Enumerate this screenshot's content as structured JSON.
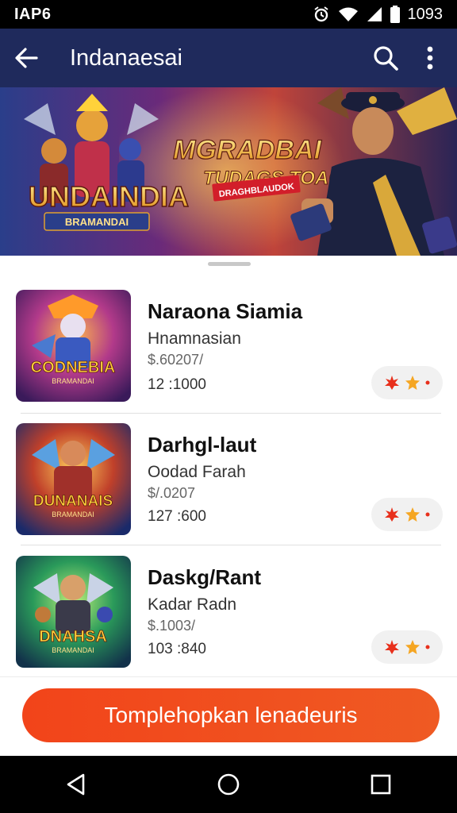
{
  "status_bar": {
    "left_label": "IAP6",
    "time": "1093"
  },
  "app_bar": {
    "title": "Indanaesai",
    "back_icon": "arrow-left-icon",
    "search_icon": "search-icon",
    "menu_icon": "more-vert-icon"
  },
  "banner": {
    "left_logo": "UNDAINDIA",
    "left_logo_sub": "BRAMANDAI",
    "headline_line1": "MGRADBAI",
    "headline_line2": "TUDAGS TOAG!",
    "ribbon": "DRAGHBLAUDOK"
  },
  "list": [
    {
      "title": "Naraona Siamia",
      "subtitle": "Hnamnasian",
      "price": "$.60207/",
      "stat": "12 :1000",
      "thumb_text": "CODNEBIA",
      "thumb_sub": "BRAMANDAI",
      "rating_icons": [
        "flame-icon",
        "star-icon",
        "dot-icon"
      ]
    },
    {
      "title": "Darhgl-laut",
      "subtitle": "Oodad Farah",
      "price": "$/.0207",
      "stat": "127 :600",
      "thumb_text": "DUNANAIS",
      "thumb_sub": "BRAMANDAI",
      "rating_icons": [
        "flame-icon",
        "star-icon",
        "dot-icon"
      ]
    },
    {
      "title": "Daskg/Rant",
      "subtitle": "Kadar Radn",
      "price": "$.1003/",
      "stat": "103 :840",
      "thumb_text": "DNAHSA",
      "thumb_sub": "BRAMANDAI",
      "rating_icons": [
        "flame-icon",
        "star-icon",
        "dot-icon"
      ]
    }
  ],
  "cta": {
    "label": "Tomplehopkan lenadeuris"
  },
  "nav": {
    "back": "nav-back-icon",
    "home": "nav-home-icon",
    "recents": "nav-recents-icon"
  },
  "colors": {
    "app_bar": "#1f2a5c",
    "accent": "#f2441a",
    "rating_red": "#e8301c",
    "rating_orange": "#f5a623"
  }
}
